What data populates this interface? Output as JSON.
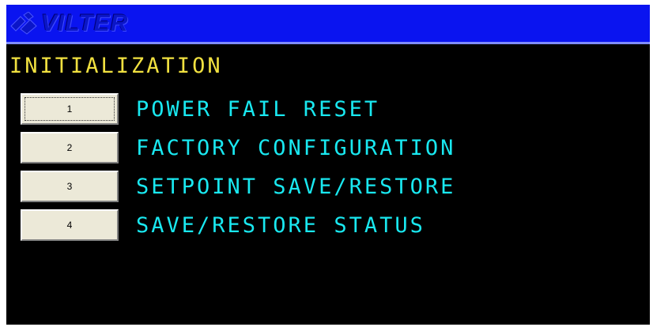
{
  "header": {
    "logo_text": "VILTER",
    "logo_icon": "vilter-logo-mark",
    "background_color": "#0a14f0"
  },
  "screen": {
    "title": "INITIALIZATION",
    "title_color": "#f0e040",
    "label_color": "#19e8f0"
  },
  "menu": {
    "items": [
      {
        "button_label": "1",
        "label": "POWER FAIL RESET"
      },
      {
        "button_label": "2",
        "label": "FACTORY CONFIGURATION"
      },
      {
        "button_label": "3",
        "label": "SETPOINT SAVE/RESTORE"
      },
      {
        "button_label": "4",
        "label": "SAVE/RESTORE STATUS"
      }
    ]
  }
}
